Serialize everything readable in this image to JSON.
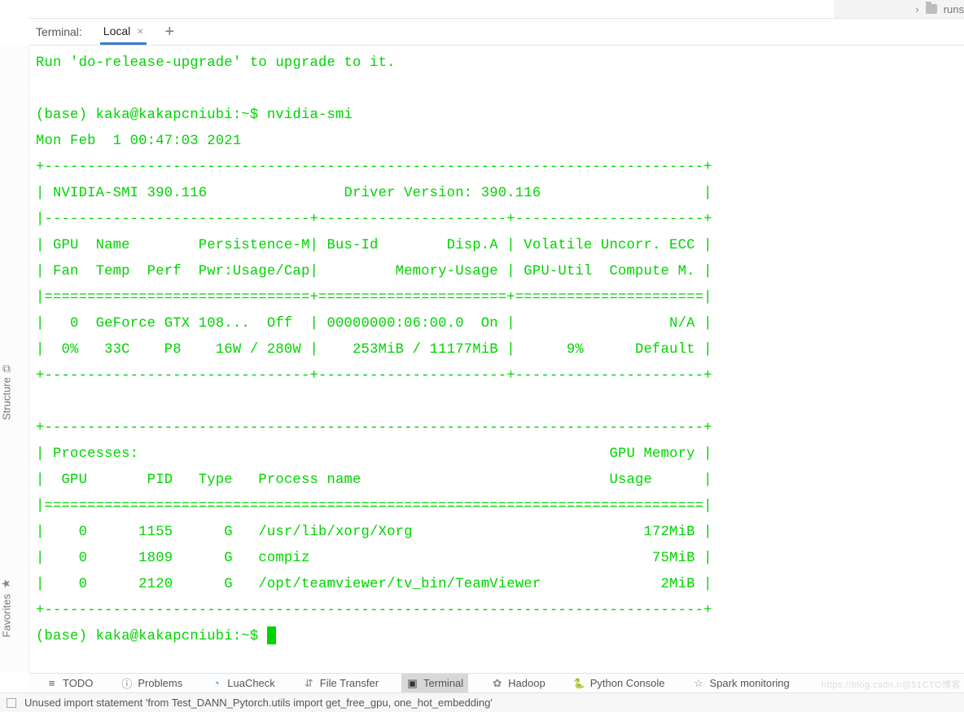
{
  "project": {
    "folder_name": "runs"
  },
  "terminal_header": {
    "panel_label": "Terminal:",
    "tab_label": "Local"
  },
  "terminal": {
    "upgrade_line": "Run 'do-release-upgrade' to upgrade to it.",
    "prompt1": "(base) kaka@kakapcniubi:~$ nvidia-smi",
    "date_line": "Mon Feb  1 00:47:03 2021",
    "smi_block": "+-----------------------------------------------------------------------------+\n| NVIDIA-SMI 390.116                Driver Version: 390.116                   |\n|-------------------------------+----------------------+----------------------+\n| GPU  Name        Persistence-M| Bus-Id        Disp.A | Volatile Uncorr. ECC |\n| Fan  Temp  Perf  Pwr:Usage/Cap|         Memory-Usage | GPU-Util  Compute M. |\n|===============================+======================+======================|\n|   0  GeForce GTX 108...  Off  | 00000000:06:00.0  On |                  N/A |\n|  0%   33C    P8    16W / 280W |    253MiB / 11177MiB |      9%      Default |\n+-------------------------------+----------------------+----------------------+\n                                                                               \n+-----------------------------------------------------------------------------+\n| Processes:                                                       GPU Memory |\n|  GPU       PID   Type   Process name                             Usage      |\n|=============================================================================|\n|    0      1155      G   /usr/lib/xorg/Xorg                           172MiB |\n|    0      1809      G   compiz                                        75MiB |\n|    0      2120      G   /opt/teamviewer/tv_bin/TeamViewer              2MiB |\n+-----------------------------------------------------------------------------+",
    "prompt2": "(base) kaka@kakapcniubi:~$ "
  },
  "sidebar": {
    "structure": "Structure",
    "favorites": "Favorites"
  },
  "bottom_tabs": {
    "todo": "TODO",
    "problems": "Problems",
    "luacheck": "LuaCheck",
    "filetransfer": "File Transfer",
    "terminal": "Terminal",
    "hadoop": "Hadoop",
    "python": "Python Console",
    "spark": "Spark monitoring"
  },
  "status": {
    "message": "Unused import statement 'from Test_DANN_Pytorch.utils import get_free_gpu, one_hot_embedding'"
  },
  "watermark": "https://blog.csdn.n@51CTO博客"
}
